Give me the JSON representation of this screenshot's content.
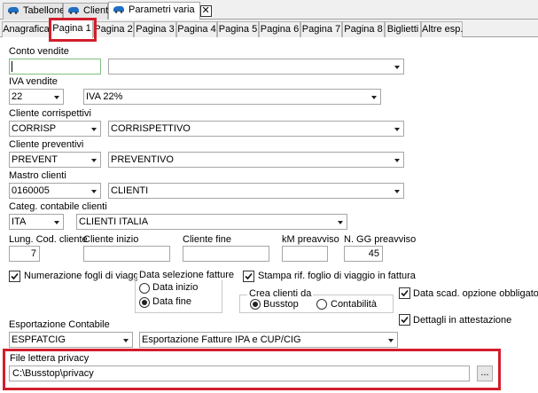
{
  "doc_tabs": [
    {
      "label": "Tabellone",
      "active": false
    },
    {
      "label": "Clienti",
      "active": false
    },
    {
      "label": "Parametri varia",
      "active": true
    }
  ],
  "close_glyph": "✕",
  "page_tabs": [
    "Anagrafica",
    "Pagina 1",
    "Pagina 2",
    "Pagina 3",
    "Pagina 4",
    "Pagina 5",
    "Pagina 6",
    "Pagina 7",
    "Pagina 8",
    "Biglietti",
    "Altre esp."
  ],
  "active_page_tab": "Pagina 1",
  "form": {
    "conto_vendite": {
      "label": "Conto vendite",
      "code": "",
      "description": ""
    },
    "iva_vendite": {
      "label": "IVA vendite",
      "code": "22",
      "description": "IVA 22%"
    },
    "cliente_corrispettivi": {
      "label": "Cliente corrispettivi",
      "code": "CORRISP",
      "description": "CORRISPETTIVO"
    },
    "cliente_preventivi": {
      "label": "Cliente preventivi",
      "code": "PREVENT",
      "description": "PREVENTIVO"
    },
    "mastro_clienti": {
      "label": "Mastro clienti",
      "code": "0160005",
      "description": "CLIENTI"
    },
    "categ_contabile": {
      "label": "Categ. contabile clienti",
      "code": "ITA",
      "description": "CLIENTI ITALIA"
    },
    "lung_cod_cliente": {
      "label": "Lung. Cod. cliente",
      "value": "7"
    },
    "cliente_inizio": {
      "label": "Cliente inizio",
      "value": ""
    },
    "cliente_fine": {
      "label": "Cliente fine",
      "value": ""
    },
    "km_preavviso": {
      "label": "kM preavviso",
      "value": ""
    },
    "n_gg_preavviso": {
      "label": "N. GG preavviso",
      "value": "45"
    },
    "numerazione_fogli": {
      "label": "Numerazione fogli di viaggio",
      "checked": true
    },
    "data_selezione": {
      "label": "Data selezione fatture",
      "options": [
        "Data inizio",
        "Data fine"
      ],
      "selected": "Data fine"
    },
    "stampa_rif": {
      "label": "Stampa rif. foglio di viaggio in fattura",
      "checked": true
    },
    "crea_clienti": {
      "label": "Crea clienti da",
      "options": [
        "Busstop",
        "Contabilità"
      ],
      "selected": "Busstop"
    },
    "data_scad": {
      "label": "Data scad. opzione obbligatoria",
      "checked": true
    },
    "dettagli": {
      "label": "Dettagli in attestazione",
      "checked": true
    },
    "esportazione": {
      "label": "Esportazione Contabile",
      "code": "ESPFATCIG",
      "description": "Esportazione Fatture IPA e CUP/CIG"
    },
    "file_privacy": {
      "label": "File lettera privacy",
      "value": "C:\\Busstop\\privacy",
      "browse_label": "..."
    }
  },
  "colors": {
    "highlight": "#d21e2b",
    "tab_bar": "#f0f0f0",
    "focus_border": "#7fbf7f"
  },
  "icons": {
    "doc_tab_icon": "bus-icon",
    "checkbox_mark": "check-icon",
    "dropdown": "chevron-down-icon"
  }
}
